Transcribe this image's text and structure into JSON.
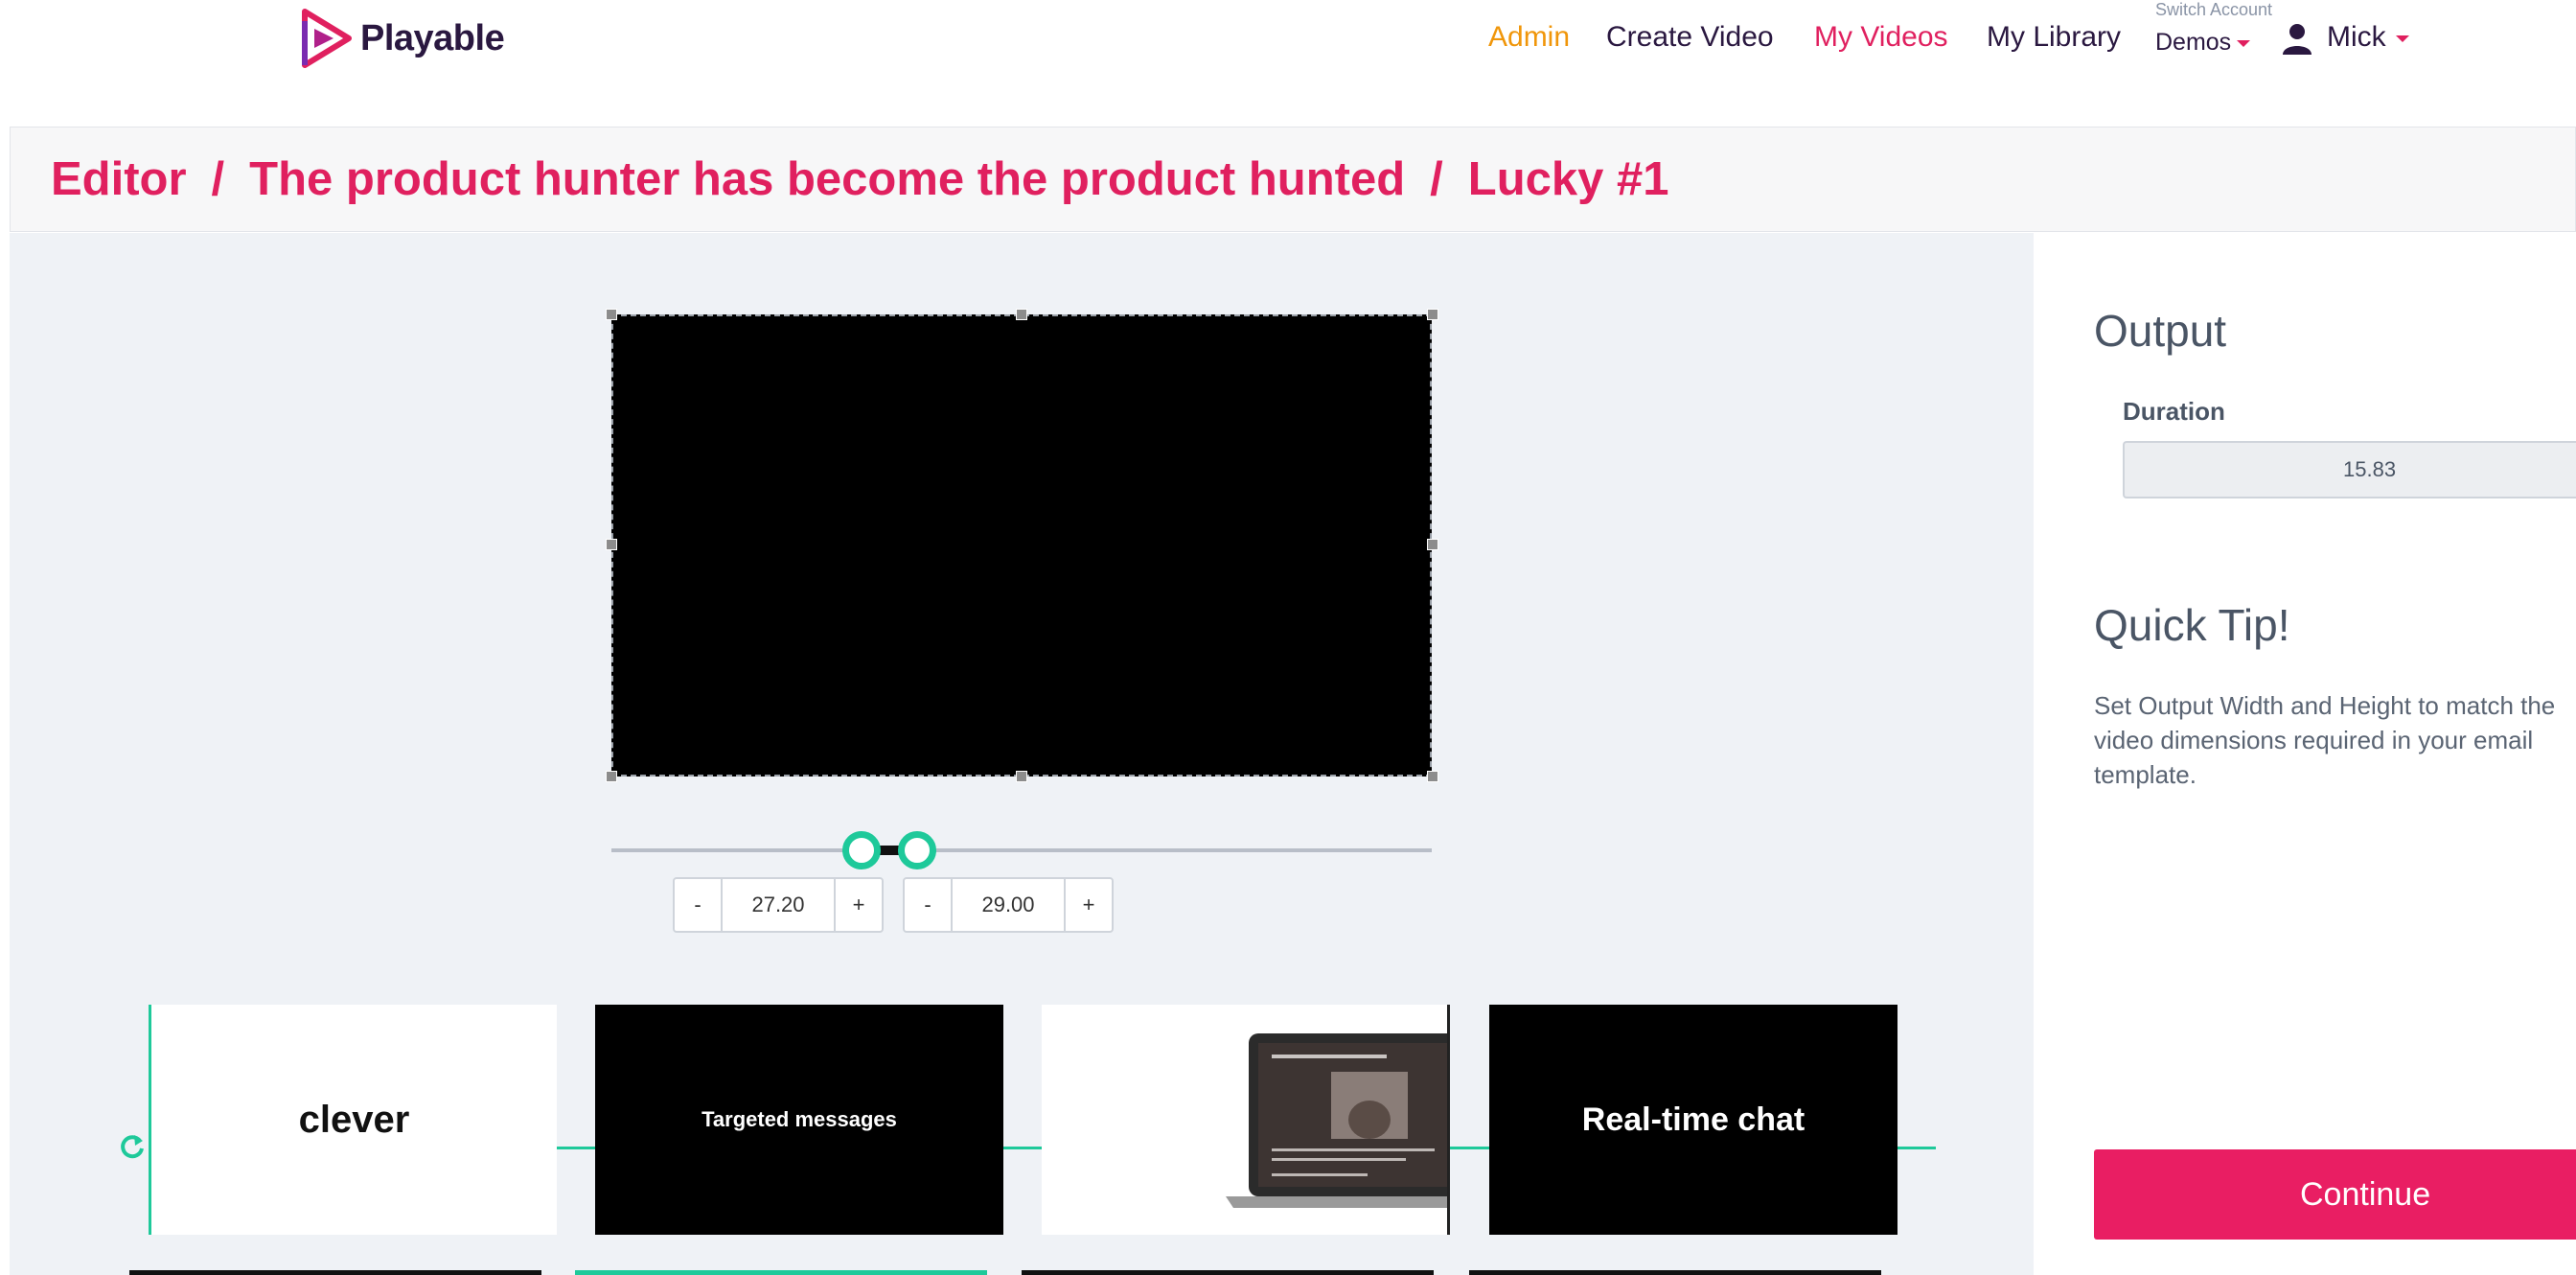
{
  "brand": {
    "name": "Playable"
  },
  "nav": {
    "admin": "Admin",
    "create_video": "Create Video",
    "my_videos": "My Videos",
    "my_library": "My Library",
    "switch_account_label": "Switch Account",
    "account": "Demos",
    "user": "Mick"
  },
  "breadcrumb": {
    "items": [
      "Editor",
      "The product hunter has become the product hunted",
      "Lucky #1"
    ],
    "separator": "/"
  },
  "trim": {
    "start": {
      "minus": "-",
      "value": "27.20",
      "plus": "+"
    },
    "end": {
      "minus": "-",
      "value": "29.00",
      "plus": "+"
    }
  },
  "timeline": {
    "clips": [
      {
        "text": "clever",
        "theme": "white"
      },
      {
        "text": "Targeted messages",
        "theme": "black"
      },
      {
        "text": "",
        "theme": "white"
      },
      {
        "text": "Real-time chat",
        "theme": "black"
      }
    ]
  },
  "panel": {
    "output_heading": "Output",
    "duration_label": "Duration",
    "duration_value": "15.83",
    "tip_heading": "Quick Tip!",
    "tip_text": "Set Output Width and Height to match the video dimensions required in your email template.",
    "continue_label": "Continue"
  },
  "colors": {
    "accent": "#e0205f",
    "admin": "#f0960a",
    "slider": "#1ec99a",
    "continue": "#e91e63"
  },
  "icons": [
    "playable-logo-icon",
    "user-icon",
    "caret-down-icon",
    "refresh-icon",
    "laptop-icon"
  ]
}
